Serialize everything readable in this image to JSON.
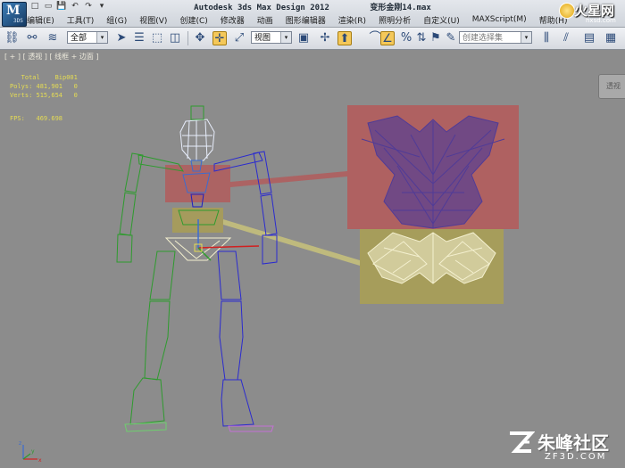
{
  "app": {
    "logo_text": "3DS",
    "window_title": "Autodesk 3ds Max Design 2012",
    "file_name": "变形金刚14.max"
  },
  "quick_access": [
    "□",
    "▭",
    "💾",
    "↶",
    "↷",
    "▾"
  ],
  "menu": [
    "编辑(E)",
    "工具(T)",
    "组(G)",
    "视图(V)",
    "创建(C)",
    "修改器",
    "动画",
    "图形编辑器",
    "渲染(R)",
    "照明分析",
    "自定义(U)",
    "MAXScript(M)",
    "帮助(H)"
  ],
  "toolbar": {
    "selection_filter": "全部",
    "reference_coord": "视图",
    "snap_value": "3",
    "named_selection_placeholder": "创建选择集",
    "selection_filter_arrow": "▾",
    "reference_coord_arrow": "▾",
    "named_selection_arrow": "▾"
  },
  "viewport": {
    "label": "[ + ] [ 透视 ] [ 线框 + 边面 ]",
    "stats": {
      "header": "   Total    Bip001",
      "polys": "Polys: 481,901   0",
      "verts": "Verts: 515,654   0",
      "fps": "FPS:   469.698"
    },
    "viewcube_label": "透视",
    "axis": {
      "x": "x",
      "y": "y",
      "z": "z"
    }
  },
  "watermarks": {
    "top_big": "火星网",
    "top_small": "hxsd.com",
    "bottom_big": "朱峰社区",
    "bottom_small": "ZF3D.COM"
  },
  "colors": {
    "viewport_bg": "#8c8c8c",
    "stats_text": "#e6dd53",
    "skeleton_green": "#2e9b2e",
    "skeleton_blue": "#2b2bcf",
    "head_white": "#e8eefc",
    "highlight_red": "#b25c5c",
    "highlight_yellow": "#a99e55",
    "wire_purple": "#4b3a9a",
    "wire_cream": "#f4f0cf"
  }
}
